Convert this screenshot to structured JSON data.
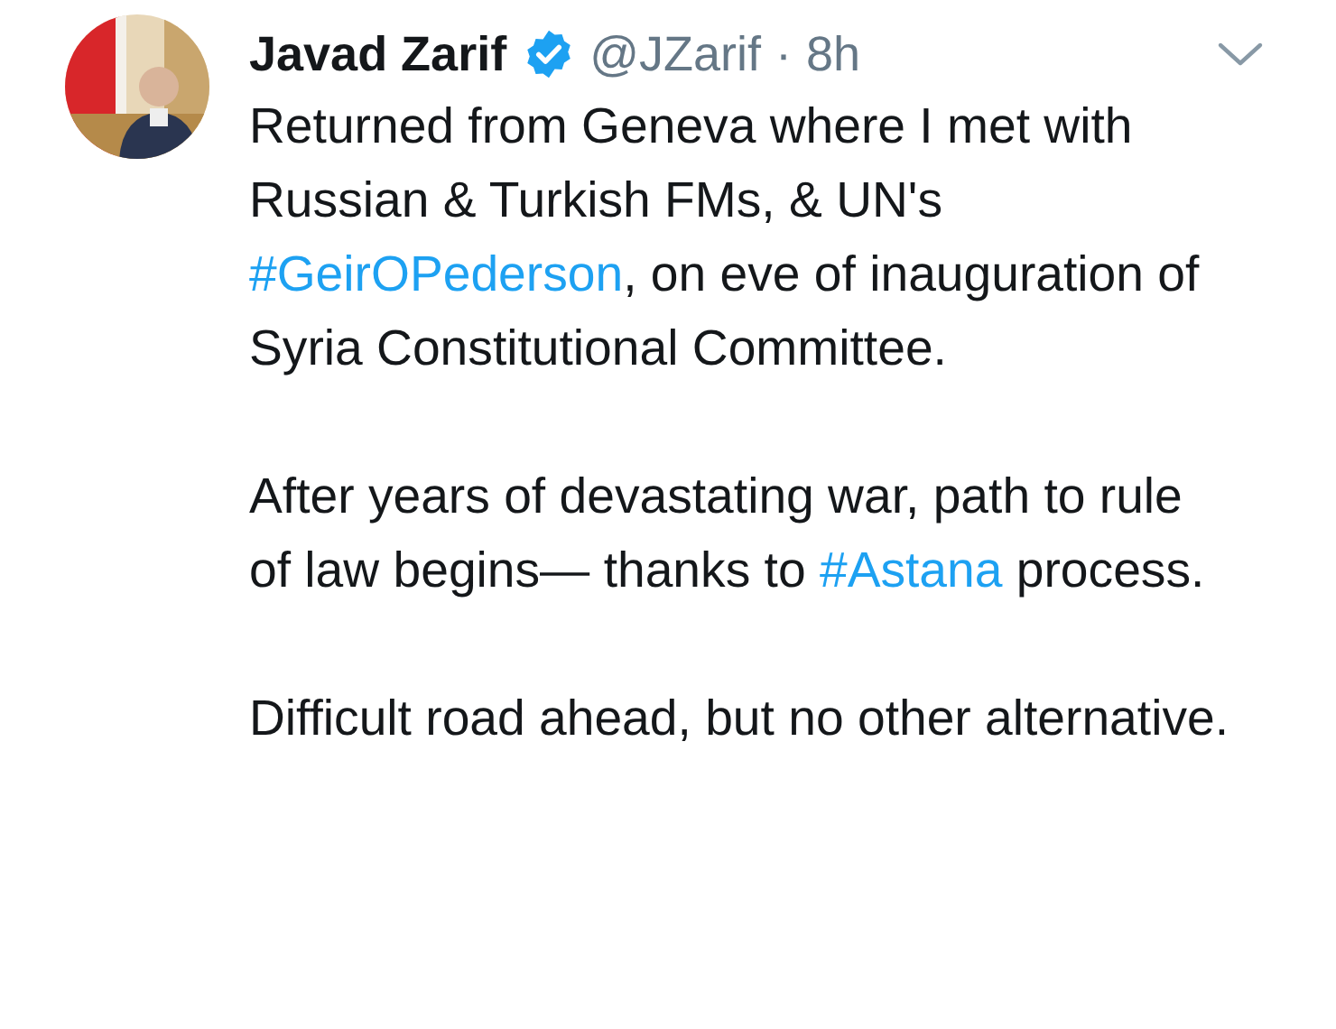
{
  "tweet": {
    "name": "Javad Zarif",
    "verified": true,
    "handle": "@JZarif",
    "separator": "·",
    "time": "8h",
    "paragraphs": [
      [
        {
          "kind": "text",
          "text": "Returned from Geneva where I met with Russian & Turkish FMs, & UN's "
        },
        {
          "kind": "hashtag",
          "text": "#GeirOPederson"
        },
        {
          "kind": "text",
          "text": ", on eve of inauguration of Syria Constitutional Committee."
        }
      ],
      [
        {
          "kind": "text",
          "text": "After years of devastating war, path to rule of law begins— thanks to "
        },
        {
          "kind": "hashtag",
          "text": "#Astana"
        },
        {
          "kind": "text",
          "text": " process."
        }
      ],
      [
        {
          "kind": "text",
          "text": "Difficult road ahead, but no other alternative."
        }
      ]
    ]
  }
}
